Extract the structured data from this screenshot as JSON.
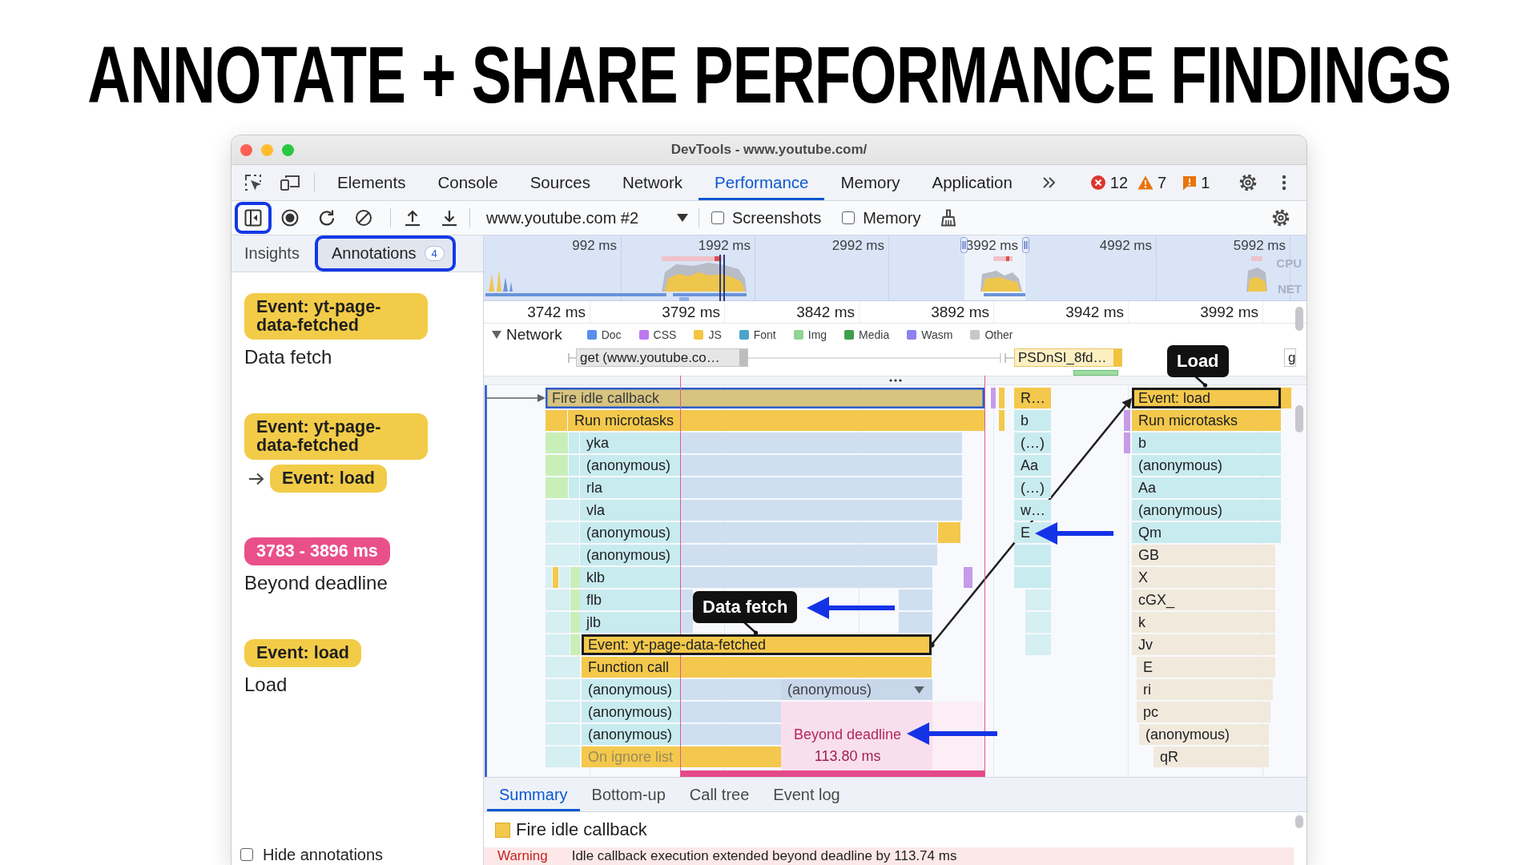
{
  "headline": "ANNOTATE + SHARE PERFORMANCE FINDINGS",
  "window": {
    "title": "DevTools - www.youtube.com/"
  },
  "panel_tabs": [
    {
      "label": "Elements",
      "selected": false
    },
    {
      "label": "Console",
      "selected": false
    },
    {
      "label": "Sources",
      "selected": false
    },
    {
      "label": "Network",
      "selected": false
    },
    {
      "label": "Performance",
      "selected": true
    },
    {
      "label": "Memory",
      "selected": false
    },
    {
      "label": "Application",
      "selected": false
    }
  ],
  "issue_counters": [
    {
      "kind": "error",
      "count": "12"
    },
    {
      "kind": "warning",
      "count": "7"
    },
    {
      "kind": "issue",
      "count": "1"
    }
  ],
  "toolbar": {
    "buttons": [
      {
        "kind": "sidebar",
        "highlighted": true
      },
      {
        "kind": "record",
        "highlighted": false
      },
      {
        "kind": "reload",
        "highlighted": false
      },
      {
        "kind": "clear",
        "highlighted": false
      },
      {
        "kind": "upload",
        "highlighted": false
      },
      {
        "kind": "download",
        "highlighted": false
      }
    ],
    "recording": "www.youtube.com #2",
    "options": [
      {
        "label": "Screenshots",
        "checked": false
      },
      {
        "label": "Memory",
        "checked": false
      }
    ]
  },
  "sidebar": {
    "tabs": [
      {
        "label": "Insights",
        "selected": false,
        "highlighted": false
      },
      {
        "label": "Annotations",
        "selected": true,
        "highlighted": true,
        "badge": "4"
      }
    ],
    "annotations": [
      {
        "kind": "entry",
        "entry": "Event: yt-page-data-fetched",
        "note": "Data fetch"
      },
      {
        "kind": "link",
        "entry": "Event: yt-page-data-fetched",
        "target": "Event: load"
      },
      {
        "kind": "range",
        "range": "3783 - 3896 ms",
        "note": "Beyond deadline"
      },
      {
        "kind": "entry",
        "entry": "Event: load",
        "note": "Load"
      }
    ],
    "hide_annotations": {
      "label": "Hide annotations",
      "checked": false
    }
  },
  "overview": {
    "ticks": [
      "992 ms",
      "1992 ms",
      "2992 ms",
      "3992 ms",
      "4992 ms",
      "5992 ms"
    ],
    "tracks": [
      "CPU",
      "NET"
    ]
  },
  "ruler": {
    "ticks": [
      "3742 ms",
      "3792 ms",
      "3842 ms",
      "3892 ms",
      "3942 ms",
      "3992 ms"
    ]
  },
  "network": {
    "label": "Network",
    "expanded": true,
    "legend": [
      {
        "label": "Doc",
        "color": "#5a8eef"
      },
      {
        "label": "CSS",
        "color": "#bd78f0"
      },
      {
        "label": "JS",
        "color": "#f4c542"
      },
      {
        "label": "Font",
        "color": "#4aa3c9"
      },
      {
        "label": "Img",
        "color": "#8fd595"
      },
      {
        "label": "Media",
        "color": "#3f9f4c"
      },
      {
        "label": "Wasm",
        "color": "#8c82f0"
      },
      {
        "label": "Other",
        "color": "#c8c8c8"
      }
    ],
    "requests": [
      {
        "label": "get (www.youtube.co…",
        "kind": "doc"
      },
      {
        "label": "PSDnSI_8fd…",
        "kind": "script"
      },
      {
        "label": "g",
        "kind": "other"
      }
    ]
  },
  "flame_chart": {
    "groups": [
      {
        "entries": [
          {
            "label": "Fire idle callback",
            "kind": "idle",
            "selected": true,
            "annotated": false
          },
          {
            "label": "Run microtasks",
            "kind": "task",
            "selected": false,
            "annotated": false
          },
          {
            "label": "yka",
            "kind": "script",
            "selected": false,
            "annotated": false
          },
          {
            "label": "(anonymous)",
            "kind": "script",
            "selected": false,
            "annotated": false
          },
          {
            "label": "rla",
            "kind": "script",
            "selected": false,
            "annotated": false
          },
          {
            "label": "vla",
            "kind": "script",
            "selected": false,
            "annotated": false
          },
          {
            "label": "(anonymous)",
            "kind": "script",
            "selected": false,
            "annotated": false
          },
          {
            "label": "(anonymous)",
            "kind": "script",
            "selected": false,
            "annotated": false
          },
          {
            "label": "klb",
            "kind": "script",
            "selected": false,
            "annotated": false
          },
          {
            "label": "flb",
            "kind": "script",
            "selected": false,
            "annotated": false
          },
          {
            "label": "jlb",
            "kind": "script",
            "selected": false,
            "annotated": false
          },
          {
            "label": "Event: yt-page-data-fetched",
            "kind": "task",
            "selected": false,
            "annotated": true
          },
          {
            "label": "Function call",
            "kind": "task",
            "selected": false,
            "annotated": false
          },
          {
            "label": "(anonymous)",
            "kind": "script",
            "selected": false,
            "annotated": false
          },
          {
            "label": "(anonymous)",
            "kind": "collapsed",
            "selected": false,
            "annotated": false
          },
          {
            "label": "(anonymous)",
            "kind": "script",
            "selected": false,
            "annotated": false
          },
          {
            "label": "(anonymous)",
            "kind": "script",
            "selected": false,
            "annotated": false
          },
          {
            "label": "On ignore list",
            "kind": "ignored",
            "selected": false,
            "annotated": false
          }
        ]
      },
      {
        "entries": [
          {
            "label": "R…",
            "kind": "task",
            "selected": false,
            "annotated": false
          },
          {
            "label": "b",
            "kind": "script",
            "selected": false,
            "annotated": false
          },
          {
            "label": "(…)",
            "kind": "script",
            "selected": false,
            "annotated": false
          },
          {
            "label": "Aa",
            "kind": "script",
            "selected": false,
            "annotated": false
          },
          {
            "label": "(…)",
            "kind": "script",
            "selected": false,
            "annotated": false
          },
          {
            "label": "w…",
            "kind": "script",
            "selected": false,
            "annotated": false
          },
          {
            "label": "E",
            "kind": "script",
            "selected": false,
            "annotated": false
          }
        ]
      },
      {
        "entries": [
          {
            "label": "Event: load",
            "kind": "task",
            "selected": false,
            "annotated": true
          },
          {
            "label": "Run microtasks",
            "kind": "task",
            "selected": false,
            "annotated": false
          },
          {
            "label": "b",
            "kind": "script",
            "selected": false,
            "annotated": false
          },
          {
            "label": "(anonymous)",
            "kind": "script",
            "selected": false,
            "annotated": false
          },
          {
            "label": "Aa",
            "kind": "script",
            "selected": false,
            "annotated": false
          },
          {
            "label": "(anonymous)",
            "kind": "script",
            "selected": false,
            "annotated": false
          },
          {
            "label": "Qm",
            "kind": "script",
            "selected": false,
            "annotated": false
          },
          {
            "label": "GB",
            "kind": "library",
            "selected": false,
            "annotated": false
          },
          {
            "label": "X",
            "kind": "library",
            "selected": false,
            "annotated": false
          },
          {
            "label": "cGX_",
            "kind": "library",
            "selected": false,
            "annotated": false
          },
          {
            "label": "k",
            "kind": "library",
            "selected": false,
            "annotated": false
          },
          {
            "label": "Jv",
            "kind": "library",
            "selected": false,
            "annotated": false
          },
          {
            "label": "E",
            "kind": "library",
            "selected": false,
            "annotated": false
          },
          {
            "label": "ri",
            "kind": "library",
            "selected": false,
            "annotated": false
          },
          {
            "label": "pc",
            "kind": "library",
            "selected": false,
            "annotated": false
          },
          {
            "label": "(anonymous)",
            "kind": "library",
            "selected": false,
            "annotated": false
          },
          {
            "label": "qR",
            "kind": "library",
            "selected": false,
            "annotated": false
          }
        ]
      }
    ],
    "labels": [
      {
        "text": "Data fetch"
      },
      {
        "text": "Load"
      }
    ],
    "range": {
      "label": "Beyond deadline",
      "duration": "113.80 ms"
    }
  },
  "details": {
    "tabs": [
      {
        "label": "Summary",
        "selected": true
      },
      {
        "label": "Bottom-up",
        "selected": false
      },
      {
        "label": "Call tree",
        "selected": false
      },
      {
        "label": "Event log",
        "selected": false
      }
    ],
    "title": "Fire idle callback",
    "warning": {
      "label": "Warning",
      "message": "Idle callback execution extended beyond deadline by 113.74 ms"
    }
  }
}
